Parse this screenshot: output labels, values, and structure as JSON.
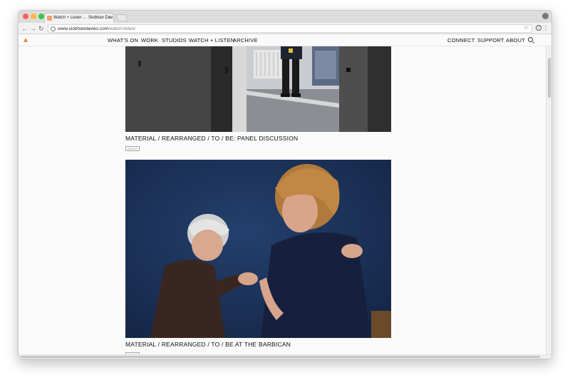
{
  "browser": {
    "tab_title": "Watch + Listen ← Siobhan Dav",
    "tab_close": "×",
    "url_host": "www.siobhandavies.com",
    "url_path": "/watch-listen/",
    "back_glyph": "←",
    "forward_glyph": "→",
    "reload_glyph": "↻",
    "star_glyph": "☆",
    "menu_glyph": "⋮",
    "ext_glyph": "i"
  },
  "site_nav": {
    "left_items": [
      "WHAT'S ON",
      "WORK",
      "STUDIOS",
      "WATCH + LISTEN",
      "ARCHIVE"
    ],
    "right_items": [
      "CONNECT",
      "SUPPORT",
      "ABOUT"
    ]
  },
  "entries": [
    {
      "title": "MATERIAL / REARRANGED / TO / BE: PANEL DISCUSSION",
      "tag": "AUDIO"
    },
    {
      "title": "MATERIAL / REARRANGED / TO / BE AT THE BARBICAN",
      "tag": "VIDEO"
    }
  ],
  "colors": {
    "accent": "#f08a3c",
    "photo2_backdrop": "#1b2d4f"
  },
  "icons": {
    "logo": "triangle-logo-icon",
    "search": "search-icon",
    "bookmark": "star-icon",
    "menu": "kebab-menu-icon"
  }
}
